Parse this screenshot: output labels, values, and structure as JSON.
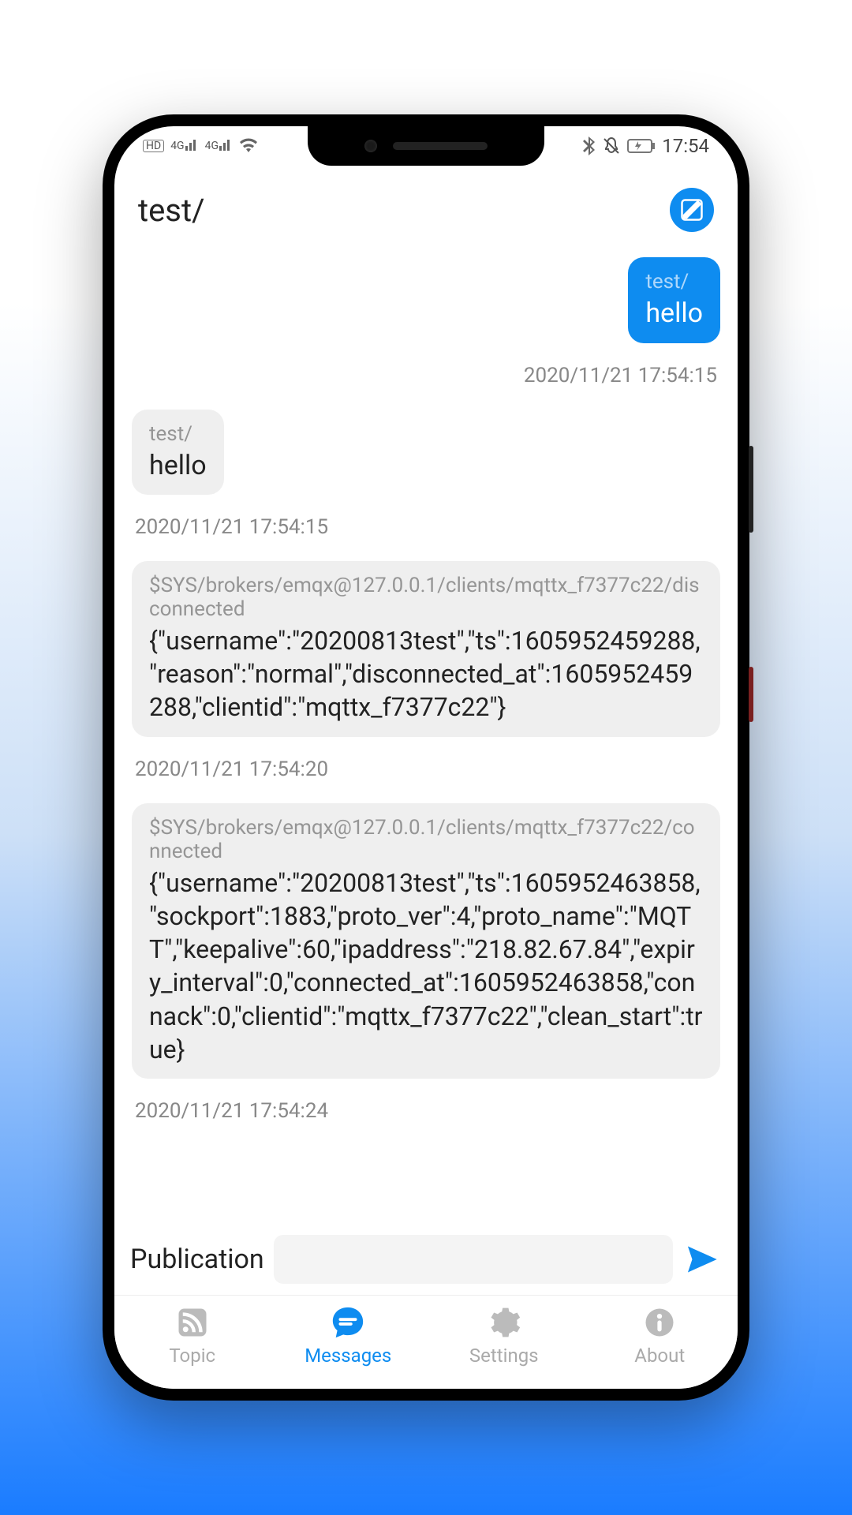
{
  "status": {
    "left_hd": "HD",
    "left_4g1": "4G",
    "left_4g2": "4G",
    "time": "17:54"
  },
  "header": {
    "title": "test/"
  },
  "messages": [
    {
      "dir": "sent",
      "topic": "test/",
      "payload": "hello",
      "ts": "2020/11/21 17:54:15"
    },
    {
      "dir": "recv",
      "topic": "test/",
      "payload": "hello",
      "ts": "2020/11/21 17:54:15"
    },
    {
      "dir": "recv",
      "topic": "$SYS/brokers/emqx@127.0.0.1/clients/mqttx_f7377c22/disconnected",
      "payload": "{\"username\":\"20200813test\",\"ts\":1605952459288,\"reason\":\"normal\",\"disconnected_at\":1605952459288,\"clientid\":\"mqttx_f7377c22\"}",
      "ts": "2020/11/21 17:54:20",
      "sys": true
    },
    {
      "dir": "recv",
      "topic": "$SYS/brokers/emqx@127.0.0.1/clients/mqttx_f7377c22/connected",
      "payload": "{\"username\":\"20200813test\",\"ts\":1605952463858,\"sockport\":1883,\"proto_ver\":4,\"proto_name\":\"MQTT\",\"keepalive\":60,\"ipaddress\":\"218.82.67.84\",\"expiry_interval\":0,\"connected_at\":1605952463858,\"connack\":0,\"clientid\":\"mqttx_f7377c22\",\"clean_start\":true}",
      "ts": "2020/11/21 17:54:24",
      "sys": true
    }
  ],
  "input": {
    "label": "Publication",
    "value": ""
  },
  "nav": {
    "items": [
      {
        "id": "topic",
        "label": "Topic",
        "active": false
      },
      {
        "id": "messages",
        "label": "Messages",
        "active": true
      },
      {
        "id": "settings",
        "label": "Settings",
        "active": false
      },
      {
        "id": "about",
        "label": "About",
        "active": false
      }
    ]
  }
}
